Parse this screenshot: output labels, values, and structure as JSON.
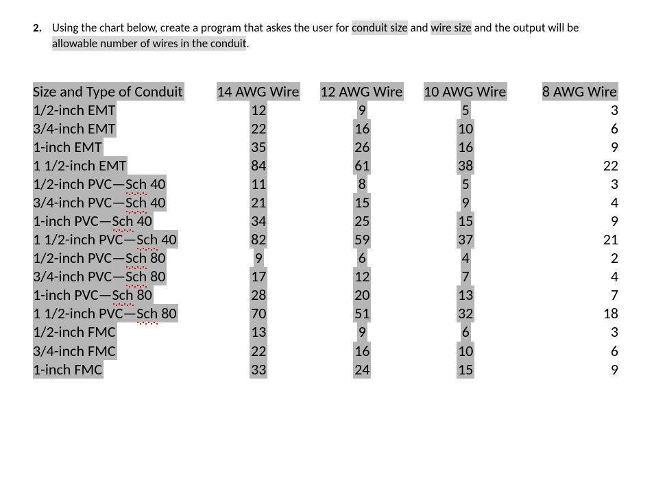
{
  "question": {
    "number": "2.",
    "pre": "Using the chart below, create a program that askes the user for ",
    "hl1": "conduit size",
    "mid1": " and ",
    "hl2": "wire size",
    "mid2": " and the output will be ",
    "hl3": "allowable number of wires in the conduit",
    "post": "."
  },
  "headers": {
    "conduit": "Size and Type of Conduit",
    "c14": "14 AWG Wire",
    "c12": "12 AWG Wire",
    "c10": "10 AWG Wire",
    "c8": "8 AWG Wire"
  },
  "rows": [
    {
      "label": "1/2-inch EMT",
      "v14": "12",
      "v12": "9",
      "v10": "5",
      "v8": "3",
      "sch": false
    },
    {
      "label": "3/4-inch EMT",
      "v14": "22",
      "v12": "16",
      "v10": "10",
      "v8": "6",
      "sch": false
    },
    {
      "label": "1-inch EMT",
      "v14": "35",
      "v12": "26",
      "v10": "16",
      "v8": "9",
      "sch": false
    },
    {
      "label": "1 1/2-inch  EMT",
      "v14": "84",
      "v12": "61",
      "v10": "38",
      "v8": "22",
      "sch": false
    },
    {
      "label": "1/2-inch PVC—",
      "sch_word": "Sch",
      "tail": " 40",
      "v14": "11",
      "v12": "8",
      "v10": "5",
      "v8": "3",
      "sch": true
    },
    {
      "label": "3/4-inch PVC—",
      "sch_word": "Sch",
      "tail": " 40",
      "v14": "21",
      "v12": "15",
      "v10": "9",
      "v8": "4",
      "sch": true
    },
    {
      "label": "1-inch  PVC—",
      "sch_word": "Sch",
      "tail": " 40",
      "v14": "34",
      "v12": "25",
      "v10": "15",
      "v8": "9",
      "sch": true
    },
    {
      "label": "1 1/2-inch PVC—",
      "sch_word": "Sch",
      "tail": " 40",
      "v14": "82",
      "v12": "59",
      "v10": "37",
      "v8": "21",
      "sch": true
    },
    {
      "label": "1/2-inch PVC—",
      "sch_word": "Sch",
      "tail": " 80",
      "v14": "9",
      "v12": "6",
      "v10": "4",
      "v8": "2",
      "sch": true
    },
    {
      "label": "3/4-inch PVC—",
      "sch_word": "Sch",
      "tail": " 80",
      "v14": "17",
      "v12": "12",
      "v10": "7",
      "v8": "4",
      "sch": true
    },
    {
      "label": "1-inch PVC—",
      "sch_word": "Sch",
      "tail": " 80",
      "v14": "28",
      "v12": "20",
      "v10": "13",
      "v8": "7",
      "sch": true
    },
    {
      "label": "1 1/2-inch PVC—",
      "sch_word": "Sch",
      "tail": " 80",
      "v14": "70",
      "v12": "51",
      "v10": "32",
      "v8": "18",
      "sch": true
    },
    {
      "label": "1/2-inch FMC",
      "v14": "13",
      "v12": "9",
      "v10": "6",
      "v8": "3",
      "sch": false
    },
    {
      "label": "3/4-inch  FMC",
      "v14": "22",
      "v12": "16",
      "v10": "10",
      "v8": "6",
      "sch": false
    },
    {
      "label": "1-inch FMC",
      "v14": "33",
      "v12": "24",
      "v10": "15",
      "v8": "9",
      "sch": false
    }
  ]
}
